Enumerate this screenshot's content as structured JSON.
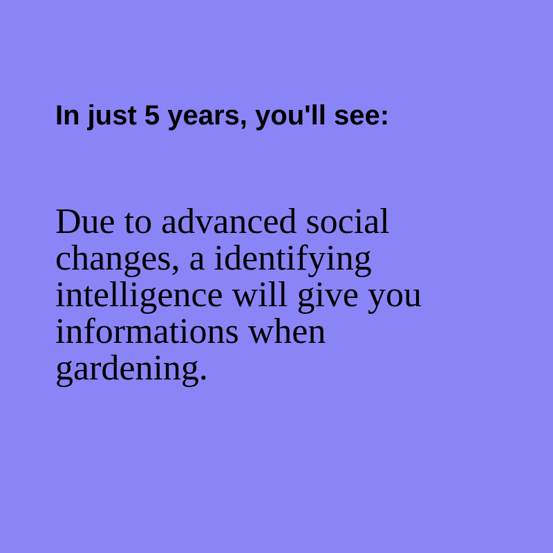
{
  "background_color": "#8a85f7",
  "text_color": "#000000",
  "heading": "In just 5 years, you'll see:",
  "body": {
    "lines": [
      "Due to advanced social",
      "changes, a identifying",
      "intelligence will give you",
      "informations when",
      "gardening."
    ]
  }
}
